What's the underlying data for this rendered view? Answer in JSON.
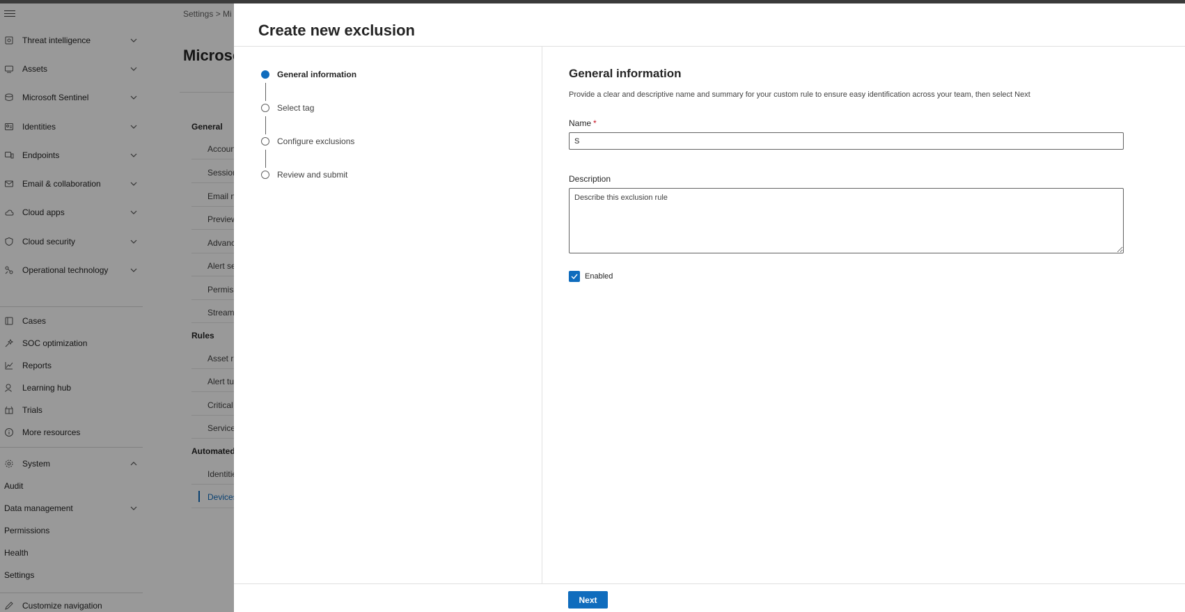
{
  "nav": {
    "items": [
      {
        "label": "Threat intelligence",
        "icon": "threat-intel-icon"
      },
      {
        "label": "Assets",
        "icon": "assets-icon"
      },
      {
        "label": "Microsoft Sentinel",
        "icon": "sentinel-icon"
      },
      {
        "label": "Identities",
        "icon": "identities-icon"
      },
      {
        "label": "Endpoints",
        "icon": "endpoints-icon"
      },
      {
        "label": "Email & collaboration",
        "icon": "email-icon"
      },
      {
        "label": "Cloud apps",
        "icon": "cloud-apps-icon"
      },
      {
        "label": "Cloud security",
        "icon": "cloud-security-icon"
      },
      {
        "label": "Operational technology",
        "icon": "ot-icon"
      }
    ],
    "links": [
      {
        "label": "Cases",
        "icon": "cases-icon"
      },
      {
        "label": "SOC optimization",
        "icon": "soc-icon"
      },
      {
        "label": "Reports",
        "icon": "reports-icon"
      },
      {
        "label": "Learning hub",
        "icon": "learning-icon"
      },
      {
        "label": "Trials",
        "icon": "trials-icon"
      },
      {
        "label": "More resources",
        "icon": "info-icon"
      }
    ],
    "system": {
      "label": "System",
      "icon": "gear-icon"
    },
    "system_items": [
      "Audit",
      "Data management",
      "Permissions",
      "Health",
      "Settings"
    ],
    "customize": "Customize navigation"
  },
  "background": {
    "breadcrumb": "Settings  >  Mi",
    "title": "Microso",
    "general_heading": "General",
    "general_items": [
      "Account",
      "Session",
      "Email no",
      "Preview",
      "Advance",
      "Alert se",
      "Permiss",
      "Streami"
    ],
    "rules_heading": "Rules",
    "rules_items": [
      "Asset ru",
      "Alert tu",
      "Critical a",
      "Service"
    ],
    "automated_heading": "Automated",
    "automated_items": [
      "Identitie",
      "Devices"
    ]
  },
  "panel": {
    "title": "Create new exclusion",
    "steps": [
      "General information",
      "Select tag",
      "Configure exclusions",
      "Review and submit"
    ],
    "current_step": 0,
    "form": {
      "heading": "General information",
      "description": "Provide a clear and descriptive name and summary for your custom rule to ensure easy identification across your team, then select Next",
      "name_label": "Name",
      "name_required": "*",
      "name_value": "S",
      "description_label": "Description",
      "description_placeholder": "Describe this exclusion rule",
      "enabled_label": "Enabled",
      "enabled": true
    },
    "next_label": "Next"
  },
  "colors": {
    "accent": "#0f6cbd",
    "overlay": "rgba(0,0,0,0.4)",
    "required": "#c50f1f"
  }
}
